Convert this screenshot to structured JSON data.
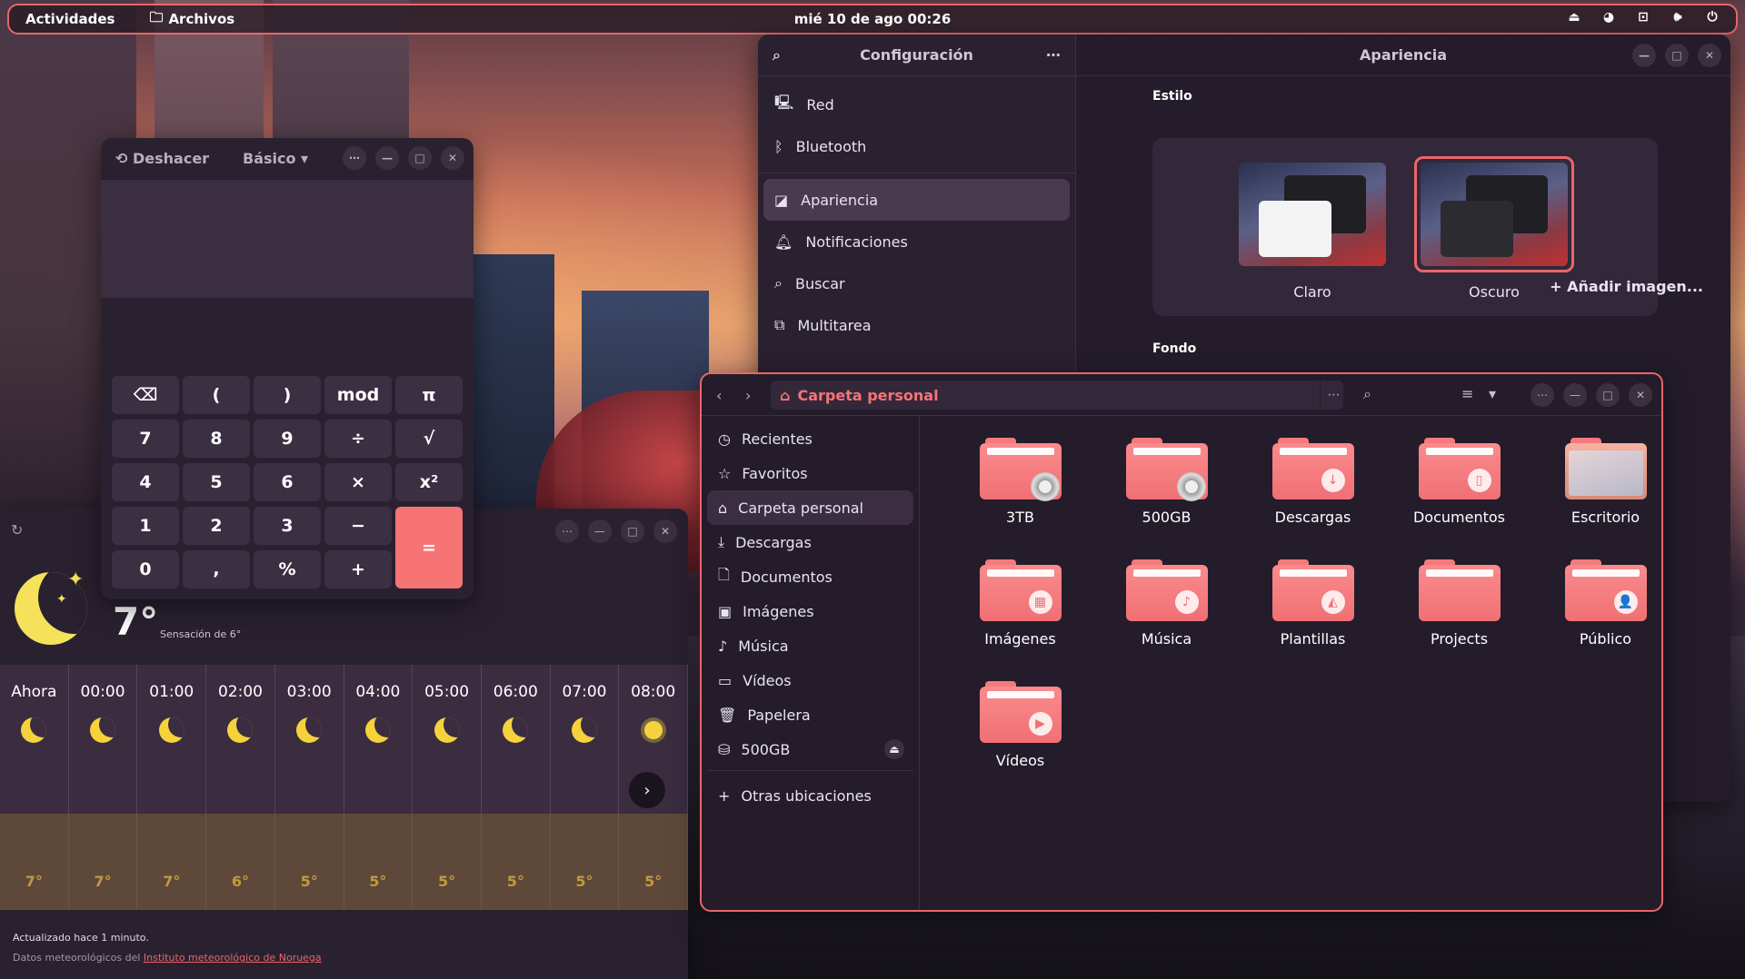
{
  "topbar": {
    "activities": "Actividades",
    "app_name": "Archivos",
    "clock": "mié 10 de ago  00:26"
  },
  "settings": {
    "title": "Configuración",
    "page_title": "Apariencia",
    "sidebar": [
      {
        "label": "Red",
        "icon": "network-icon"
      },
      {
        "label": "Bluetooth",
        "icon": "bluetooth-icon"
      },
      {
        "label": "Apariencia",
        "icon": "appearance-icon",
        "active": true
      },
      {
        "label": "Notificaciones",
        "icon": "bell-icon"
      },
      {
        "label": "Buscar",
        "icon": "search-icon"
      },
      {
        "label": "Multitarea",
        "icon": "multitask-icon"
      }
    ],
    "style_label": "Estilo",
    "style_options": [
      {
        "label": "Claro",
        "selected": false
      },
      {
        "label": "Oscuro",
        "selected": true
      }
    ],
    "background_label": "Fondo",
    "add_image": "Añadir imagen..."
  },
  "calculator": {
    "undo": "Deshacer",
    "mode": "Básico",
    "keys": [
      "⌫",
      "(",
      ")",
      "mod",
      "π",
      "7",
      "8",
      "9",
      "÷",
      "√",
      "4",
      "5",
      "6",
      "×",
      "x²",
      "1",
      "2",
      "3",
      "−",
      "=",
      "0",
      ",",
      "%",
      "+"
    ]
  },
  "weather": {
    "temp_now": "7°",
    "feels_like": "Sensación de 6°",
    "forecast": [
      {
        "time": "Ahora",
        "icon": "moon-icon",
        "temp": "7°"
      },
      {
        "time": "00:00",
        "icon": "moon-icon",
        "temp": "7°"
      },
      {
        "time": "01:00",
        "icon": "moon-icon",
        "temp": "7°"
      },
      {
        "time": "02:00",
        "icon": "moon-icon",
        "temp": "6°"
      },
      {
        "time": "03:00",
        "icon": "moon-icon",
        "temp": "5°"
      },
      {
        "time": "04:00",
        "icon": "moon-icon",
        "temp": "5°"
      },
      {
        "time": "05:00",
        "icon": "moon-icon",
        "temp": "5°"
      },
      {
        "time": "06:00",
        "icon": "moon-icon",
        "temp": "5°"
      },
      {
        "time": "07:00",
        "icon": "moon-icon",
        "temp": "5°"
      },
      {
        "time": "08:00",
        "icon": "sun-icon",
        "temp": "5°"
      }
    ],
    "updated": "Actualizado hace 1 minuto.",
    "credit_prefix": "Datos meteorológicos del ",
    "credit_link": "Instituto meteorológico de Noruega"
  },
  "files": {
    "path": "Carpeta personal",
    "sidebar": [
      {
        "label": "Recientes",
        "icon": "clock-icon"
      },
      {
        "label": "Favoritos",
        "icon": "star-icon"
      },
      {
        "label": "Carpeta personal",
        "icon": "home-icon",
        "active": true
      },
      {
        "label": "Descargas",
        "icon": "download-icon"
      },
      {
        "label": "Documentos",
        "icon": "document-icon"
      },
      {
        "label": "Imágenes",
        "icon": "image-icon"
      },
      {
        "label": "Música",
        "icon": "music-icon"
      },
      {
        "label": "Vídeos",
        "icon": "video-icon"
      },
      {
        "label": "Papelera",
        "icon": "trash-icon"
      },
      {
        "label": "500GB",
        "icon": "drive-icon",
        "eject": true
      }
    ],
    "other_locations": "Otras ubicaciones",
    "folders": [
      {
        "label": "3TB",
        "icon": "drive-folder-icon"
      },
      {
        "label": "500GB",
        "icon": "drive-folder-icon"
      },
      {
        "label": "Descargas",
        "icon": "download-folder-icon"
      },
      {
        "label": "Documentos",
        "icon": "documents-folder-icon"
      },
      {
        "label": "Escritorio",
        "icon": "desktop-folder-icon"
      },
      {
        "label": "Imágenes",
        "icon": "pictures-folder-icon"
      },
      {
        "label": "Música",
        "icon": "music-folder-icon"
      },
      {
        "label": "Plantillas",
        "icon": "templates-folder-icon"
      },
      {
        "label": "Projects",
        "icon": "folder-icon"
      },
      {
        "label": "Público",
        "icon": "public-folder-icon"
      },
      {
        "label": "Vídeos",
        "icon": "videos-folder-icon"
      }
    ]
  }
}
